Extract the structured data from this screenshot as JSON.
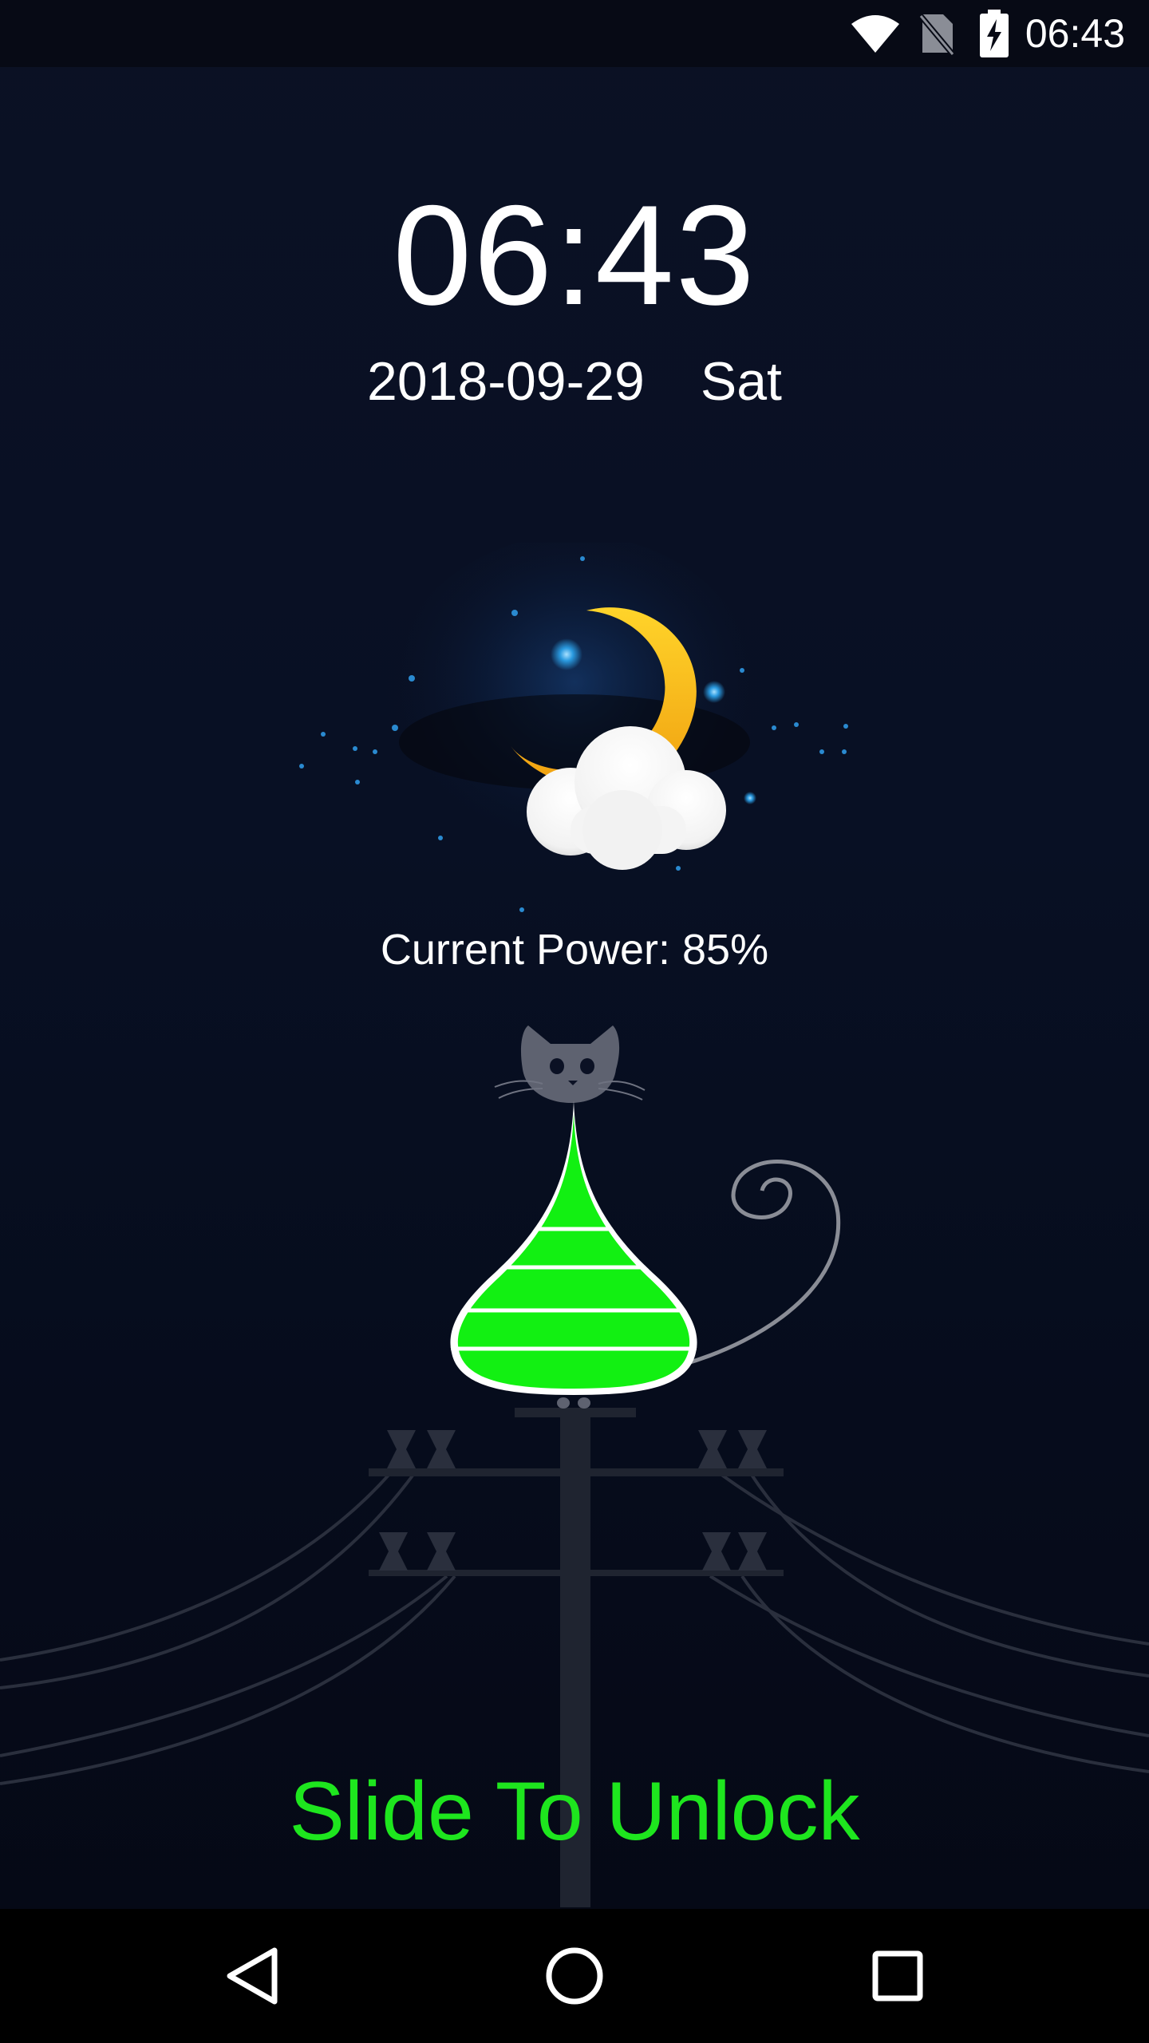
{
  "status_bar": {
    "time": "06:43",
    "icons": [
      "wifi-icon",
      "no-sim-icon",
      "battery-charging-icon"
    ]
  },
  "lockscreen": {
    "clock": "06:43",
    "date": "2018-09-29",
    "weekday": "Sat",
    "weather_icon": "moon-cloud-icon",
    "power_label": "Current Power: 85%",
    "battery_level": 0.85,
    "unlock_label": "Slide To Unlock"
  },
  "nav_bar": {
    "buttons": [
      "back-icon",
      "home-icon",
      "recents-icon"
    ]
  },
  "colors": {
    "unlock_green": "#1ee61e",
    "battery_green": "#12f012",
    "moon_yellow": "#ffc21a"
  }
}
